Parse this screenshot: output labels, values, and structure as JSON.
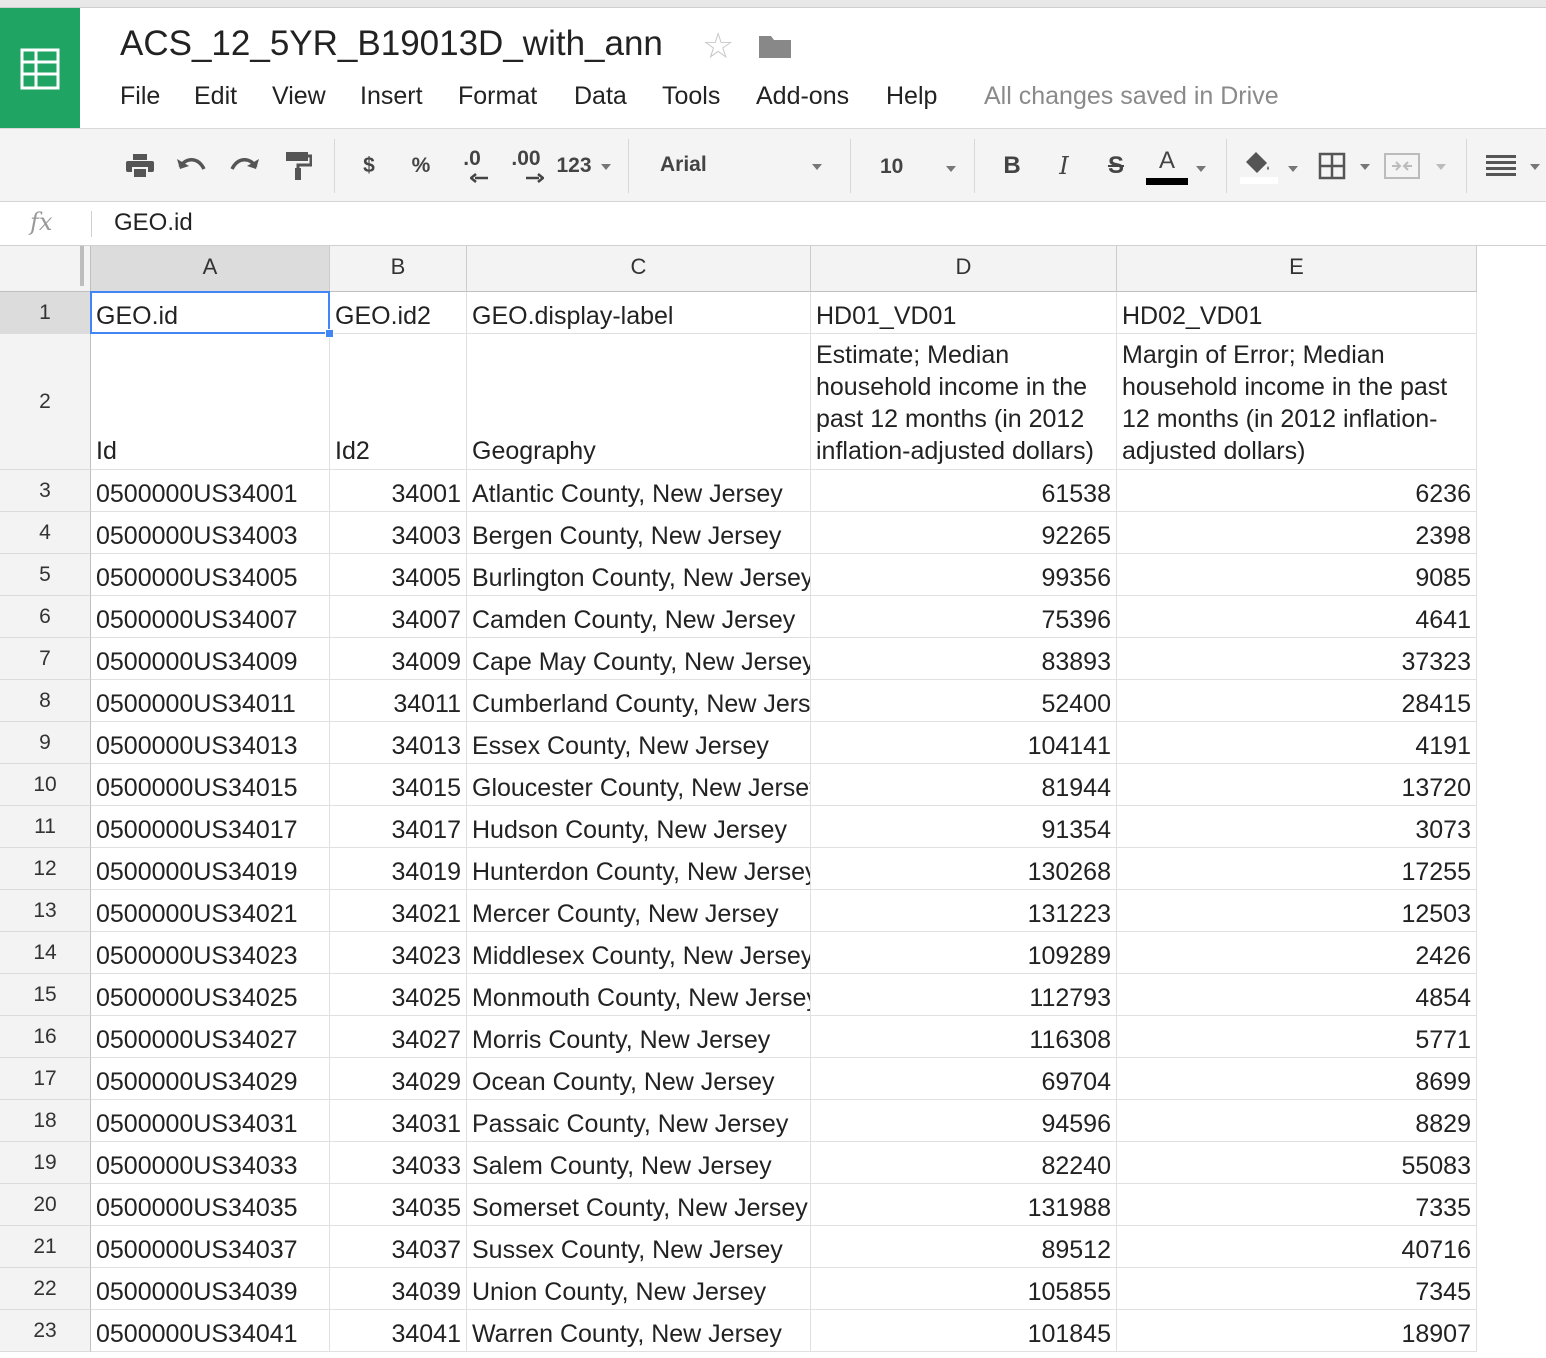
{
  "app": {
    "doc_title": "ACS_12_5YR_B19013D_with_ann",
    "save_status": "All changes saved in Drive",
    "brand_color": "#1fa463",
    "selection_color": "#4285f4"
  },
  "menu": [
    "File",
    "Edit",
    "View",
    "Insert",
    "Format",
    "Data",
    "Tools",
    "Add-ons",
    "Help"
  ],
  "toolbar": {
    "currency": "$",
    "percent": "%",
    "dec_decrease": ".0",
    "dec_increase": ".00",
    "more_formats": "123",
    "font": "Arial",
    "font_size": "10",
    "bold": "B",
    "italic": "I",
    "strike": "S",
    "text_color": "A"
  },
  "formula_bar": {
    "icon": "fx",
    "value": "GEO.id"
  },
  "sheet": {
    "columns": [
      "A",
      "B",
      "C",
      "D",
      "E"
    ],
    "active_cell": "A1",
    "rows": [
      {
        "n": "1",
        "c": [
          "GEO.id",
          "GEO.id2",
          "GEO.display-label",
          "HD01_VD01",
          "HD02_VD01"
        ]
      },
      {
        "n": "2",
        "c": [
          "Id",
          "Id2",
          "Geography",
          "Estimate; Median household income in the past 12 months (in 2012 inflation-adjusted dollars)",
          "Margin of Error; Median household income in the past 12 months (in 2012 inflation-adjusted dollars)"
        ]
      },
      {
        "n": "3",
        "c": [
          "0500000US34001",
          "34001",
          "Atlantic County, New Jersey",
          "61538",
          "6236"
        ]
      },
      {
        "n": "4",
        "c": [
          "0500000US34003",
          "34003",
          "Bergen County, New Jersey",
          "92265",
          "2398"
        ]
      },
      {
        "n": "5",
        "c": [
          "0500000US34005",
          "34005",
          "Burlington County, New Jersey",
          "99356",
          "9085"
        ]
      },
      {
        "n": "6",
        "c": [
          "0500000US34007",
          "34007",
          "Camden County, New Jersey",
          "75396",
          "4641"
        ]
      },
      {
        "n": "7",
        "c": [
          "0500000US34009",
          "34009",
          "Cape May County, New Jersey",
          "83893",
          "37323"
        ]
      },
      {
        "n": "8",
        "c": [
          "0500000US34011",
          "34011",
          "Cumberland County, New Jersey",
          "52400",
          "28415"
        ]
      },
      {
        "n": "9",
        "c": [
          "0500000US34013",
          "34013",
          "Essex County, New Jersey",
          "104141",
          "4191"
        ]
      },
      {
        "n": "10",
        "c": [
          "0500000US34015",
          "34015",
          "Gloucester County, New Jersey",
          "81944",
          "13720"
        ]
      },
      {
        "n": "11",
        "c": [
          "0500000US34017",
          "34017",
          "Hudson County, New Jersey",
          "91354",
          "3073"
        ]
      },
      {
        "n": "12",
        "c": [
          "0500000US34019",
          "34019",
          "Hunterdon County, New Jersey",
          "130268",
          "17255"
        ]
      },
      {
        "n": "13",
        "c": [
          "0500000US34021",
          "34021",
          "Mercer County, New Jersey",
          "131223",
          "12503"
        ]
      },
      {
        "n": "14",
        "c": [
          "0500000US34023",
          "34023",
          "Middlesex County, New Jersey",
          "109289",
          "2426"
        ]
      },
      {
        "n": "15",
        "c": [
          "0500000US34025",
          "34025",
          "Monmouth County, New Jersey",
          "112793",
          "4854"
        ]
      },
      {
        "n": "16",
        "c": [
          "0500000US34027",
          "34027",
          "Morris County, New Jersey",
          "116308",
          "5771"
        ]
      },
      {
        "n": "17",
        "c": [
          "0500000US34029",
          "34029",
          "Ocean County, New Jersey",
          "69704",
          "8699"
        ]
      },
      {
        "n": "18",
        "c": [
          "0500000US34031",
          "34031",
          "Passaic County, New Jersey",
          "94596",
          "8829"
        ]
      },
      {
        "n": "19",
        "c": [
          "0500000US34033",
          "34033",
          "Salem County, New Jersey",
          "82240",
          "55083"
        ]
      },
      {
        "n": "20",
        "c": [
          "0500000US34035",
          "34035",
          "Somerset County, New Jersey",
          "131988",
          "7335"
        ]
      },
      {
        "n": "21",
        "c": [
          "0500000US34037",
          "34037",
          "Sussex County, New Jersey",
          "89512",
          "40716"
        ]
      },
      {
        "n": "22",
        "c": [
          "0500000US34039",
          "34039",
          "Union County, New Jersey",
          "105855",
          "7345"
        ]
      },
      {
        "n": "23",
        "c": [
          "0500000US34041",
          "34041",
          "Warren County, New Jersey",
          "101845",
          "18907"
        ]
      }
    ]
  }
}
